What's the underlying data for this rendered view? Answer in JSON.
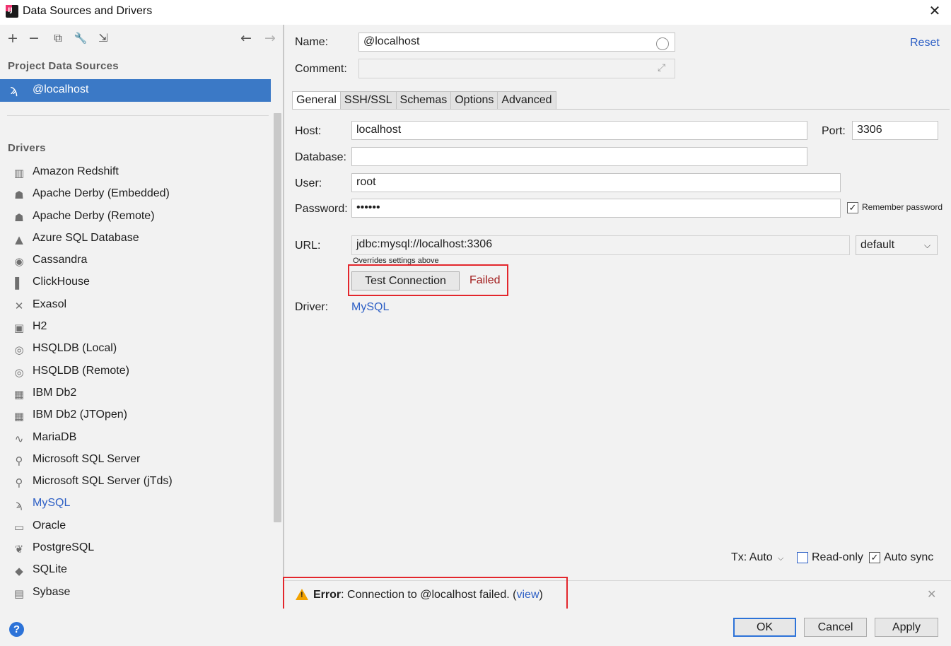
{
  "window": {
    "title": "Data Sources and Drivers",
    "close_glyph": "✕"
  },
  "left": {
    "toolbar": {
      "add": "+",
      "remove": "−",
      "duplicate": "⧉",
      "properties": "🔧",
      "import": "⇲",
      "back": "←",
      "forward": "→"
    },
    "project_section": "Project Data Sources",
    "data_source": {
      "label": "@localhost",
      "icon": "mysql-dolphin-icon"
    },
    "drivers_section": "Drivers",
    "drivers": [
      {
        "label": "Amazon Redshift",
        "icon": "redshift-icon",
        "glyph": "▥"
      },
      {
        "label": "Apache Derby (Embedded)",
        "icon": "derby-hat-icon",
        "glyph": "☗"
      },
      {
        "label": "Apache Derby (Remote)",
        "icon": "derby-hat-icon",
        "glyph": "☗"
      },
      {
        "label": "Azure SQL Database",
        "icon": "azure-icon",
        "glyph": "▲"
      },
      {
        "label": "Cassandra",
        "icon": "cassandra-eye-icon",
        "glyph": "◉"
      },
      {
        "label": "ClickHouse",
        "icon": "clickhouse-icon",
        "glyph": "▌"
      },
      {
        "label": "Exasol",
        "icon": "exasol-icon",
        "glyph": "✕"
      },
      {
        "label": "H2",
        "icon": "h2-icon",
        "glyph": "▣"
      },
      {
        "label": "HSQLDB (Local)",
        "icon": "hsqldb-icon",
        "glyph": "◎"
      },
      {
        "label": "HSQLDB (Remote)",
        "icon": "hsqldb-icon",
        "glyph": "◎"
      },
      {
        "label": "IBM Db2",
        "icon": "db2-icon",
        "glyph": "▦"
      },
      {
        "label": "IBM Db2 (JTOpen)",
        "icon": "db2-icon",
        "glyph": "▦"
      },
      {
        "label": "MariaDB",
        "icon": "mariadb-icon",
        "glyph": "∿"
      },
      {
        "label": "Microsoft SQL Server",
        "icon": "sqlserver-icon",
        "glyph": "⚲"
      },
      {
        "label": "Microsoft SQL Server (jTds)",
        "icon": "sqlserver-icon",
        "glyph": "⚲"
      },
      {
        "label": "MySQL",
        "icon": "mysql-dolphin-icon",
        "glyph": "ϡ"
      },
      {
        "label": "Oracle",
        "icon": "oracle-icon",
        "glyph": "▭"
      },
      {
        "label": "PostgreSQL",
        "icon": "postgresql-elephant-icon",
        "glyph": "❦"
      },
      {
        "label": "SQLite",
        "icon": "sqlite-icon",
        "glyph": "◆"
      },
      {
        "label": "Sybase",
        "icon": "sybase-icon",
        "glyph": "▤"
      }
    ]
  },
  "form": {
    "name_label": "Name:",
    "name_value": "@localhost",
    "comment_label": "Comment:",
    "comment_value": "",
    "reset": "Reset",
    "tabs": [
      "General",
      "SSH/SSL",
      "Schemas",
      "Options",
      "Advanced"
    ],
    "host_label": "Host:",
    "host_value": "localhost",
    "port_label": "Port:",
    "port_value": "3306",
    "database_label": "Database:",
    "database_value": "",
    "user_label": "User:",
    "user_value": "root",
    "password_label": "Password:",
    "password_value": "••••••",
    "remember_password": "Remember password",
    "url_label": "URL:",
    "url_value": "jdbc:mysql://localhost:3306",
    "url_mode": "default",
    "url_hint": "Overrides settings above",
    "test_connection": "Test Connection",
    "test_status": "Failed",
    "driver_label": "Driver:",
    "driver_value": "MySQL",
    "tx": "Tx: Auto",
    "read_only": "Read-only",
    "auto_sync": "Auto sync"
  },
  "error": {
    "prefix": "Error",
    "message": ": Connection to @localhost failed. (",
    "link": "view",
    "suffix": ")"
  },
  "buttons": {
    "ok": "OK",
    "cancel": "Cancel",
    "apply": "Apply",
    "help": "?"
  },
  "colors": {
    "selection": "#3b79c6",
    "link": "#2d5fc5",
    "error_highlight": "#e3262c",
    "failed_text": "#a11a1a"
  }
}
